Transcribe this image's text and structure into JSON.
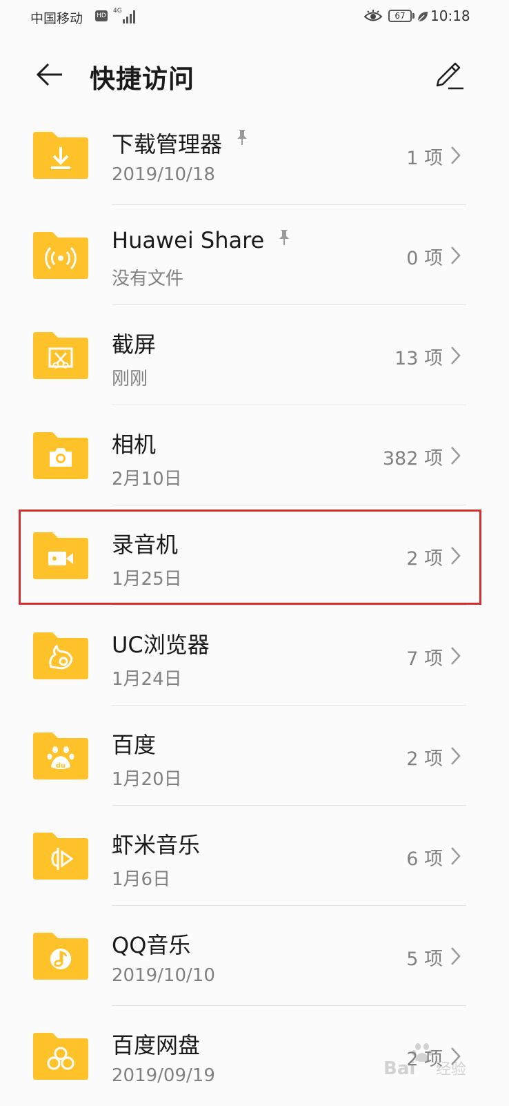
{
  "status_bar": {
    "carrier": "中国移动",
    "hd": "HD",
    "network": "4G",
    "battery": "67",
    "time": "10:18"
  },
  "header": {
    "title": "快捷访问"
  },
  "colors": {
    "folder": "#FFC22B",
    "highlight": "#d32f2f"
  },
  "items": [
    {
      "name": "下载管理器",
      "date": "2019/10/18",
      "count": "1 项",
      "pinned": true,
      "icon": "download-icon"
    },
    {
      "name": "Huawei Share",
      "date": "没有文件",
      "count": "0 项",
      "pinned": true,
      "icon": "huawei-share-icon"
    },
    {
      "name": "截屏",
      "date": "刚刚",
      "count": "13 项",
      "pinned": false,
      "icon": "screenshot-icon"
    },
    {
      "name": "相机",
      "date": "2月10日",
      "count": "382 项",
      "pinned": false,
      "icon": "camera-icon"
    },
    {
      "name": "录音机",
      "date": "1月25日",
      "count": "2 项",
      "pinned": false,
      "icon": "recorder-icon",
      "highlighted": true
    },
    {
      "name": "UC浏览器",
      "date": "1月24日",
      "count": "7 项",
      "pinned": false,
      "icon": "uc-browser-icon"
    },
    {
      "name": "百度",
      "date": "1月20日",
      "count": "2 项",
      "pinned": false,
      "icon": "baidu-paw-icon"
    },
    {
      "name": "虾米音乐",
      "date": "1月6日",
      "count": "6 项",
      "pinned": false,
      "icon": "xiami-music-icon"
    },
    {
      "name": "QQ音乐",
      "date": "2019/10/10",
      "count": "5 项",
      "pinned": false,
      "icon": "qq-music-icon"
    },
    {
      "name": "百度网盘",
      "date": "2019/09/19",
      "count": "2 项",
      "pinned": false,
      "icon": "baidu-netdisk-icon"
    }
  ]
}
